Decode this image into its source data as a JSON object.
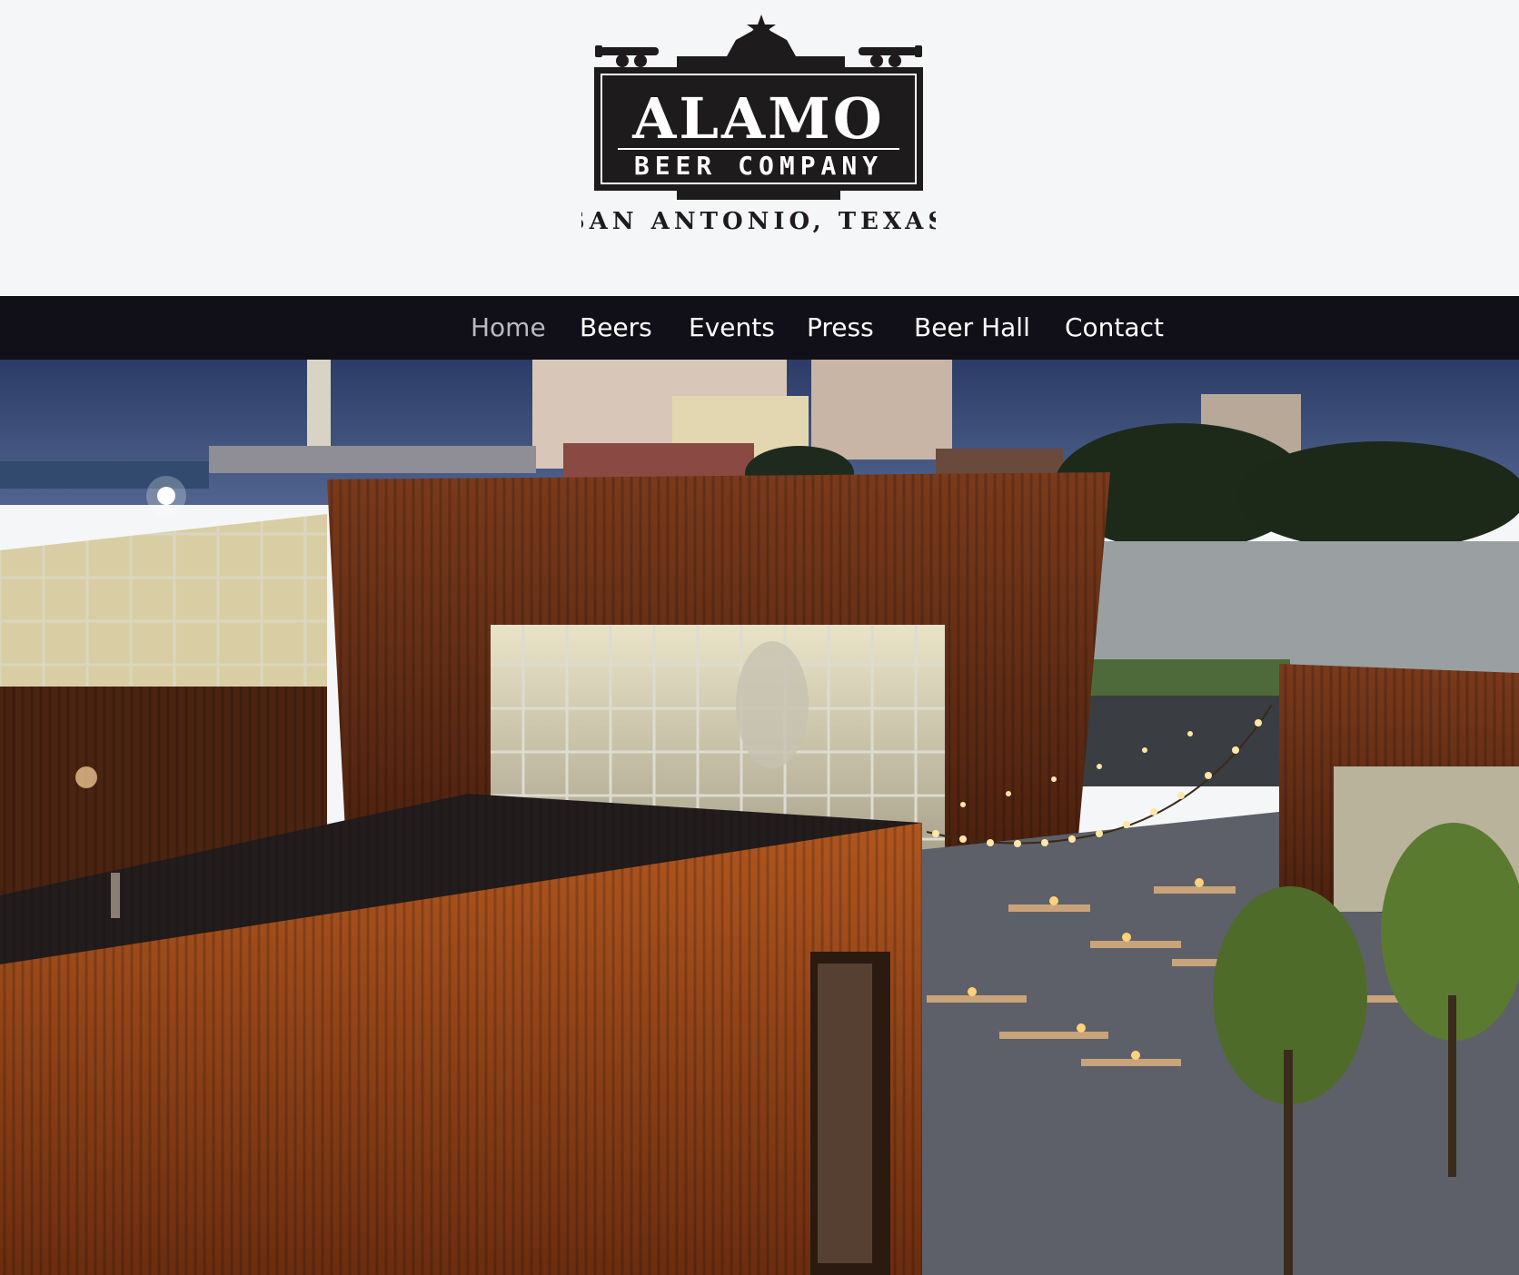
{
  "brand": {
    "name": "ALAMO",
    "subtitle": "BEER COMPANY",
    "location": "SAN ANTONIO, TEXAS",
    "colors": {
      "logo": "#1e1b1c",
      "logo_text": "#ffffff",
      "background": "#f5f6f8",
      "nav_background": "#111018",
      "nav_text": "#ffffff",
      "nav_active_text": "#b9bac2"
    }
  },
  "nav": {
    "items": [
      {
        "label": "Home",
        "active": true
      },
      {
        "label": "Beers",
        "active": false
      },
      {
        "label": "Events",
        "active": false
      },
      {
        "label": "Press",
        "active": false
      },
      {
        "label": "Beer Hall",
        "active": false
      },
      {
        "label": "Contact",
        "active": false
      }
    ]
  },
  "hero": {
    "icon": "brewery-photo"
  }
}
